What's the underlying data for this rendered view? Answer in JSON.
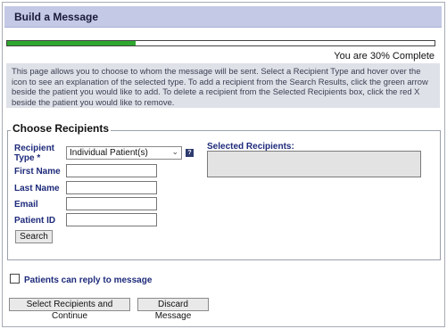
{
  "header": {
    "title": "Build a Message"
  },
  "progress": {
    "percent": 30,
    "label": "You are 30% Complete"
  },
  "info_text": "This page allows you to choose to whom the message will be sent. Select a Recipient Type and hover over the icon to see an explanation of the selected type. To add a recipient from the Search Results, click the green arrow beside the patient you would like to add. To delete a recipient from the Selected Recipients box, click the red X beside the patient you would like to remove.",
  "choose_recipients": {
    "legend": "Choose Recipients",
    "recipient_type_label": "Recipient Type *",
    "recipient_type_value": "Individual Patient(s)",
    "first_name_label": "First Name",
    "last_name_label": "Last Name",
    "email_label": "Email",
    "patient_id_label": "Patient ID",
    "search_button": "Search",
    "selected_recipients_label": "Selected Recipients:"
  },
  "reply": {
    "label": "Patients can reply to message",
    "checked": false
  },
  "actions": {
    "continue_button": "Select Recipients and Continue",
    "discard_button": "Discard Message"
  },
  "icons": {
    "help": "help-icon",
    "dropdown": "chevron-down-icon"
  },
  "colors": {
    "header_bg": "#c4c9e5",
    "progress_fill": "#2ea82e",
    "label_blue": "#1d2a7a"
  }
}
